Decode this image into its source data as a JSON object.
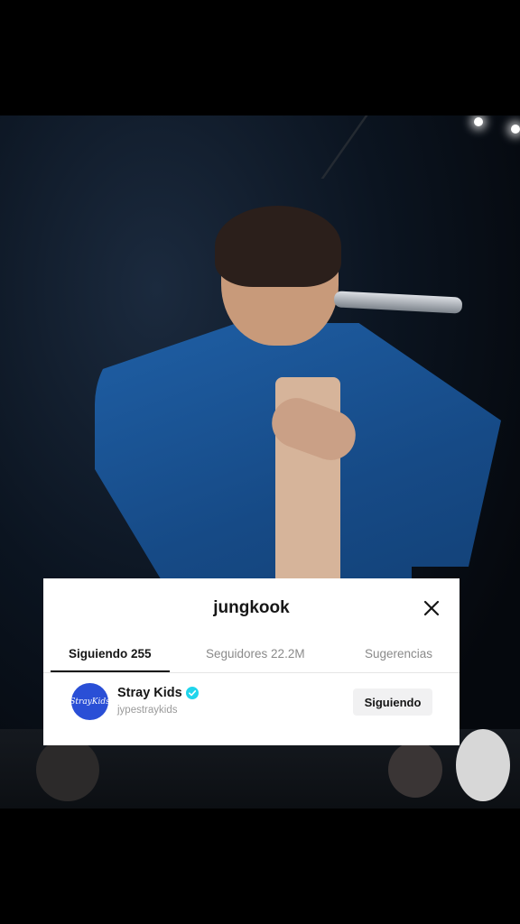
{
  "profile_panel": {
    "title": "jungkook",
    "tabs": [
      {
        "label": "Siguiendo 255",
        "active": true
      },
      {
        "label": "Seguidores 22.2M",
        "active": false
      },
      {
        "label": "Sugerencias",
        "active": false
      }
    ],
    "following_list": [
      {
        "name": "Stray Kids",
        "handle": "jypestraykids",
        "avatar_text": "StrayKids",
        "verified": true,
        "button_label": "Siguiendo"
      }
    ]
  },
  "icons": {
    "close": "close-icon",
    "verified": "verified-badge-icon"
  },
  "colors": {
    "verified_badge": "#20d5ec",
    "avatar_bg": "#2a4fd6",
    "button_bg": "#f1f1f2"
  }
}
